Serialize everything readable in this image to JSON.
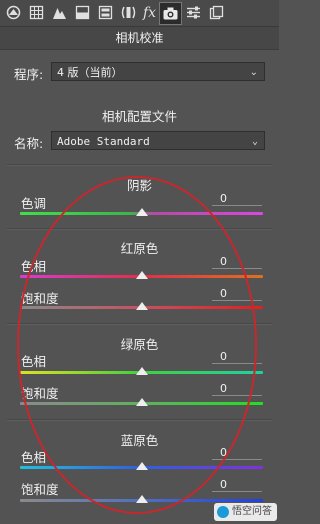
{
  "toolbar": {
    "icons": [
      "camera-basic-icon",
      "grid-icon",
      "mountain-icon",
      "split-panel-icon",
      "split-toning-icon",
      "lens-icon",
      "fx-icon",
      "camera-icon",
      "presets-icon",
      "snapshots-icon"
    ],
    "fx_label": "fx",
    "active_icon": "camera-icon"
  },
  "panel": {
    "title": "相机校准",
    "process_label": "程序:",
    "process_value": "4 版（当前）",
    "profile_section": "相机配置文件",
    "name_label": "名称:",
    "name_value": "Adobe Standard"
  },
  "shadows": {
    "title": "阴影",
    "tint_label": "色调",
    "tint_value": "0"
  },
  "red_primary": {
    "title": "红原色",
    "hue_label": "色相",
    "hue_value": "0",
    "sat_label": "饱和度",
    "sat_value": "0"
  },
  "green_primary": {
    "title": "绿原色",
    "hue_label": "色相",
    "hue_value": "0",
    "sat_label": "饱和度",
    "sat_value": "0"
  },
  "blue_primary": {
    "title": "蓝原色",
    "hue_label": "色相",
    "hue_value": "0",
    "sat_label": "饱和度",
    "sat_value": "0"
  },
  "watermark": {
    "text": "悟空问答"
  },
  "colors": {
    "annotation_oval": "#c8272c",
    "panel_bg": "#535353"
  }
}
